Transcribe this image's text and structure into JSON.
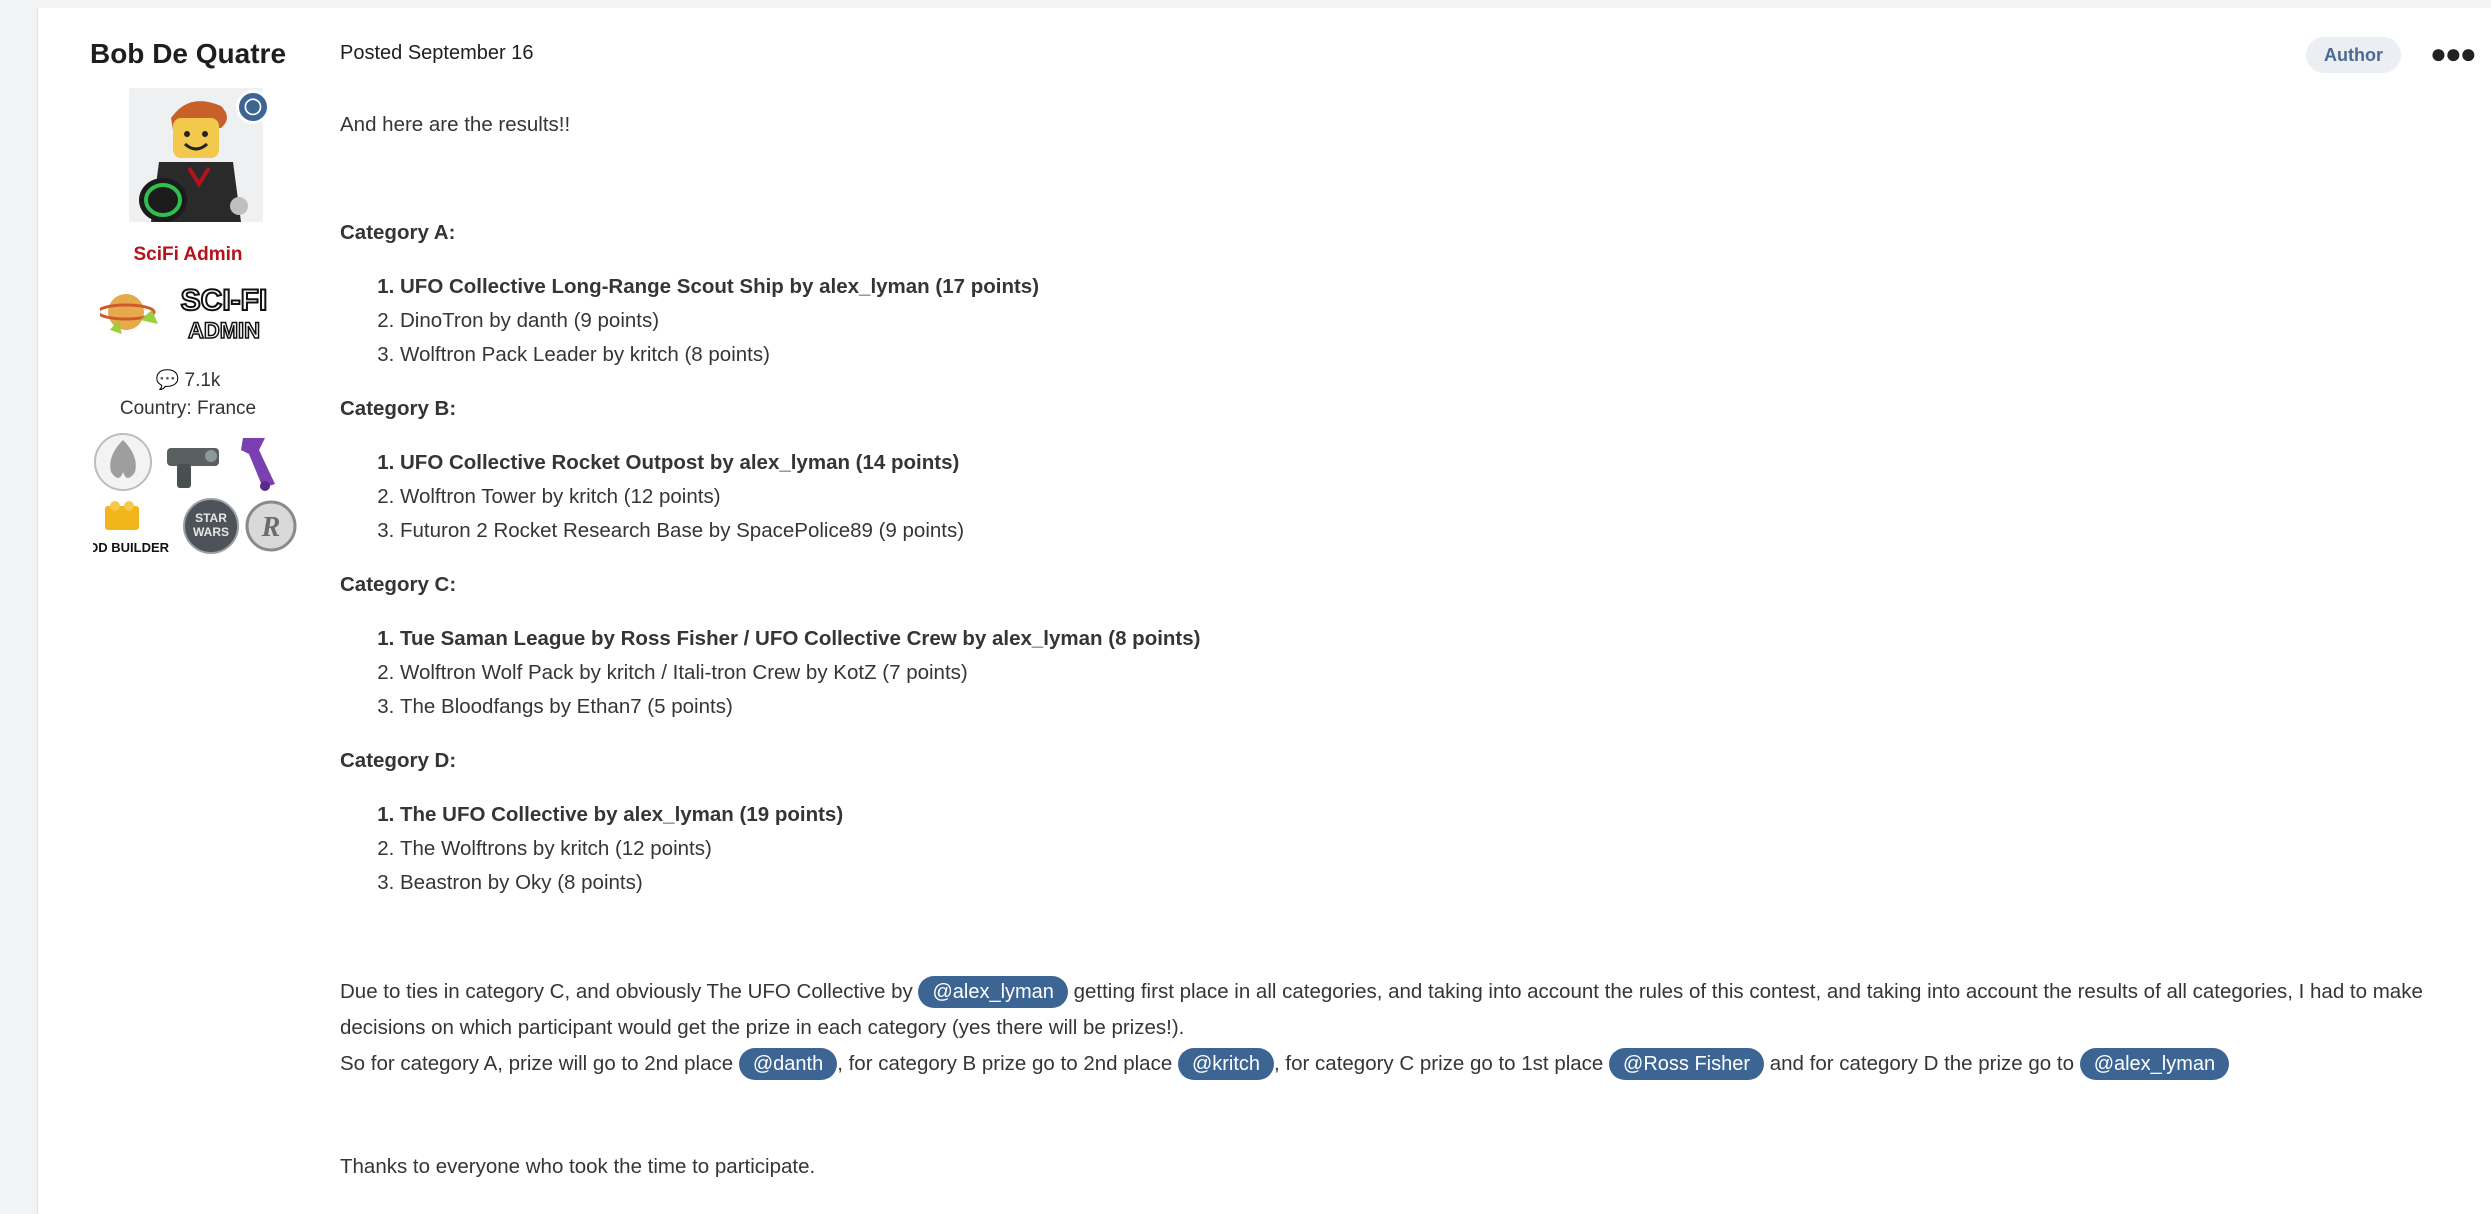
{
  "author": {
    "name": "Bob De Quatre",
    "group": "SciFi Admin",
    "group_image_text": "SCI-FI ADMIN",
    "posts_count": "7.1k",
    "country": "Country: France",
    "badge_icons": [
      "rebel-alliance-icon",
      "blaster-icon",
      "purple-tool-icon",
      "ldd-builder-icon",
      "star-wars-icon",
      "r-badge-icon"
    ],
    "ldd_label": "LDD BUILDER"
  },
  "post": {
    "posted": "Posted September 16",
    "author_badge": "Author",
    "intro": "And here are the results!!",
    "categories": [
      {
        "title": "Category A:",
        "items": [
          "UFO Collective Long-Range Scout Ship by alex_lyman (17 points)",
          "DinoTron by danth (9 points)",
          "Wolftron Pack Leader by kritch (8 points)"
        ]
      },
      {
        "title": "Category B:",
        "items": [
          "UFO Collective Rocket Outpost by alex_lyman (14 points)",
          "Wolftron Tower by kritch (12 points)",
          "Futuron 2 Rocket Research Base by SpacePolice89 (9 points)"
        ]
      },
      {
        "title": "Category C:",
        "items": [
          "Tue Saman League by Ross Fisher / UFO Collective Crew by alex_lyman (8 points)",
          "Wolftron Wolf Pack by kritch / Itali-tron Crew by KotZ (7 points)",
          "The Bloodfangs by Ethan7 (5 points)"
        ]
      },
      {
        "title": "Category D:",
        "items": [
          "The UFO Collective by alex_lyman (19 points)",
          "The Wolftrons by kritch (12 points)",
          "Beastron by Oky (8 points)"
        ]
      }
    ],
    "outro": {
      "p1_a": "Due to ties in category C, and obviously The UFO Collective by ",
      "m1": "@alex_lyman",
      "p1_b": " getting first place in all categories, and taking into account the rules of this contest, and taking into account the results of all categories, I had to make decisions on which participant would get the prize in each category  (yes there will be prizes!).",
      "p2_a": "So for category A, prize will go to 2nd place ",
      "m2": "@danth",
      "p2_b": ", for category B prize go to 2nd place ",
      "m3": "@kritch",
      "p2_c": ", for category C prize go to 1st place ",
      "m4": "@Ross Fisher",
      "p2_d": " and for category D the prize go to ",
      "m5": "@alex_lyman"
    },
    "thanks": "Thanks to everyone who took the time to participate."
  }
}
